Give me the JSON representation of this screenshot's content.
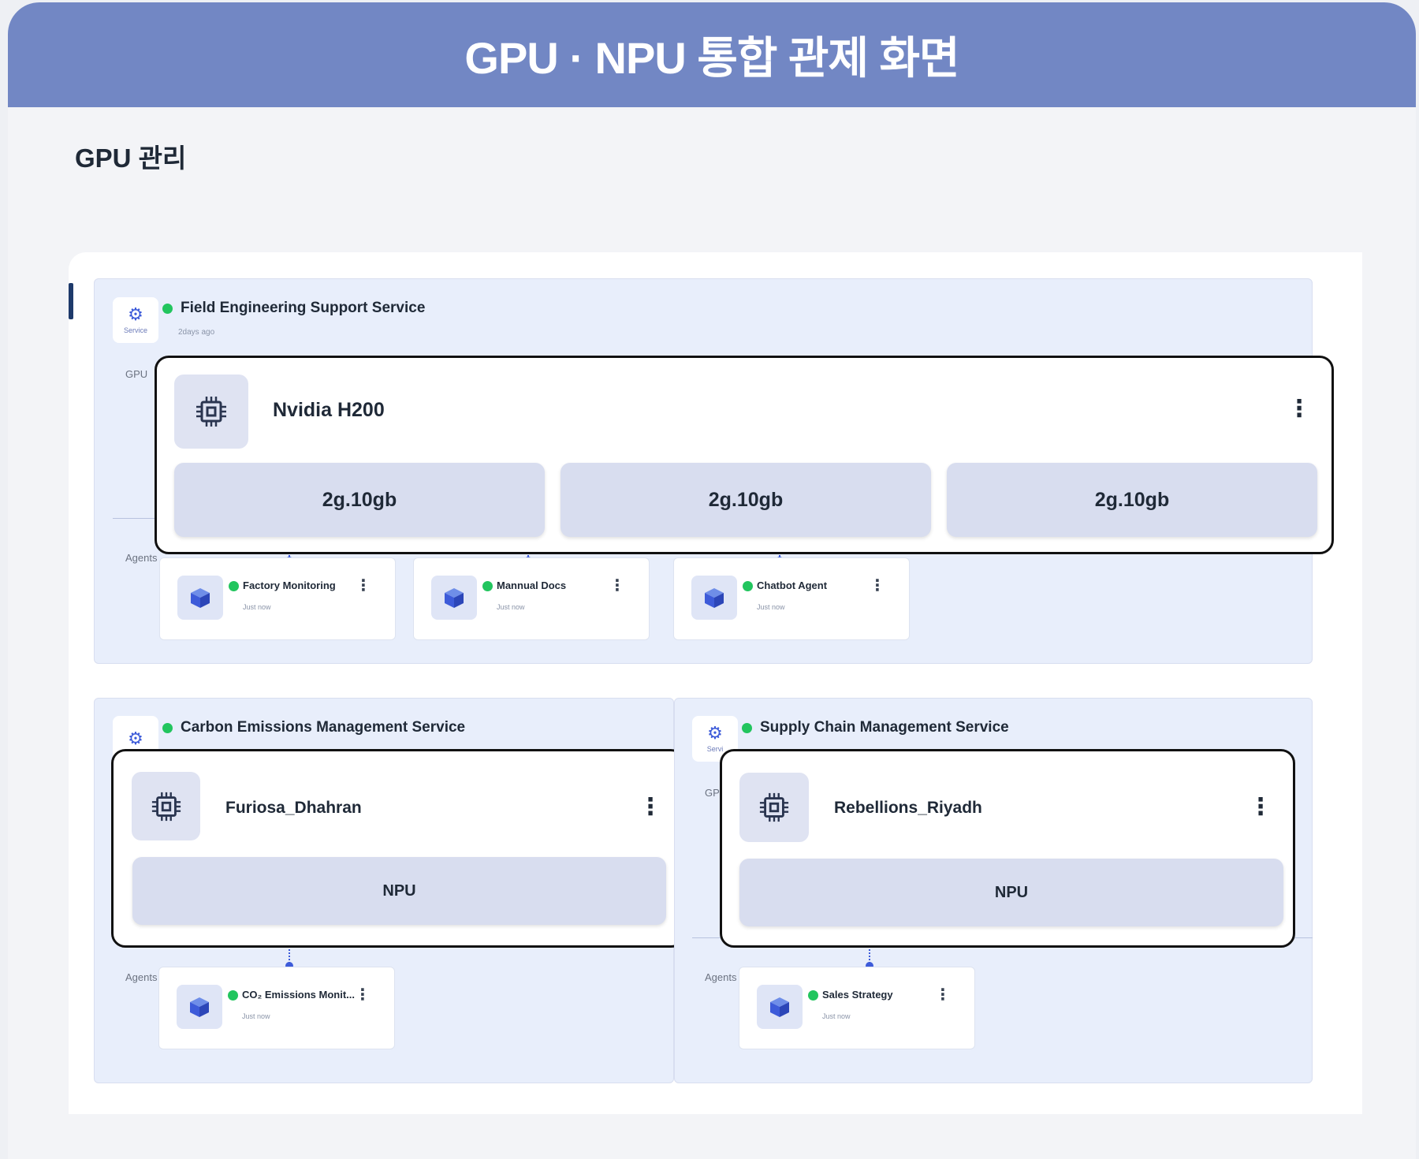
{
  "banner": {
    "title": "GPU · NPU 통합 관제 화면"
  },
  "section": {
    "title": "GPU 관리"
  },
  "services": [
    {
      "name": "Field Engineering Support Service",
      "time": "2days ago",
      "icon_caption": "Service",
      "gpu_label": "GPU",
      "agents_label": "Agents",
      "status_color": "#22c55e",
      "device": {
        "name": "Nvidia H200",
        "icon": "chip-icon",
        "slices": [
          "2g.10gb",
          "2g.10gb",
          "2g.10gb"
        ]
      },
      "agents": [
        {
          "name": "Factory Monitoring",
          "time": "Just now"
        },
        {
          "name": "Mannual Docs",
          "time": "Just now"
        },
        {
          "name": "Chatbot Agent",
          "time": "Just now"
        }
      ]
    },
    {
      "name": "Carbon Emissions Management Service",
      "agents_label": "Agents",
      "device": {
        "name": "Furiosa_Dhahran",
        "icon": "chip-icon",
        "slices": [
          "NPU"
        ]
      },
      "agents": [
        {
          "name": "CO₂ Emissions Monit...",
          "time": "Just now"
        }
      ]
    },
    {
      "name": "Supply Chain Management Service",
      "icon_caption": "Servi",
      "gpu_label": "GP",
      "agents_label": "Agents",
      "device": {
        "name": "Rebellions_Riyadh",
        "icon": "chip-icon",
        "slices": [
          "NPU"
        ]
      },
      "agents": [
        {
          "name": "Sales Strategy",
          "time": "Just now"
        }
      ]
    }
  ],
  "menu_glyph": "⋮",
  "colors": {
    "banner": "#7287c4",
    "service_bg": "#e8eefb",
    "status": "#22c55e",
    "accent": "#3d5bd9",
    "slice_bg": "#d8ddef"
  }
}
